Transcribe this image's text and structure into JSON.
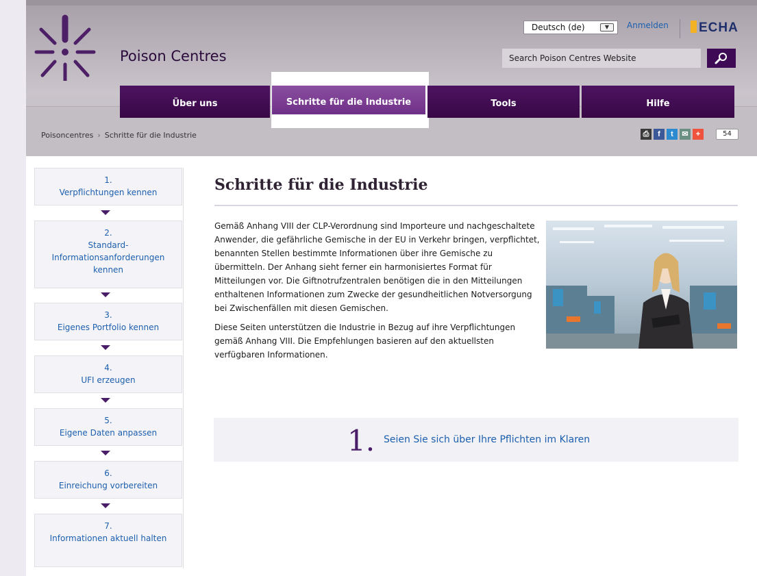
{
  "header": {
    "site_name": "Poison Centres",
    "language": "Deutsch (de)",
    "login_label": "Anmelden",
    "echa_logo_text": "ECHA",
    "search_placeholder": "Search Poison Centres Website"
  },
  "nav": {
    "tabs": [
      {
        "label": "Über uns"
      },
      {
        "label": "Schritte für die Industrie",
        "active": true
      },
      {
        "label": "Tools"
      },
      {
        "label": "Hilfe"
      }
    ]
  },
  "breadcrumb": {
    "home": "Poisoncentres",
    "separator": "›",
    "current": "Schritte für die Industrie"
  },
  "share": {
    "icons": [
      "print-icon",
      "facebook-icon",
      "twitter-icon",
      "email-icon",
      "addthis-icon"
    ],
    "count": "54"
  },
  "sidebar": {
    "steps": [
      {
        "num": "1.",
        "label": "Verpflichtungen kennen"
      },
      {
        "num": "2.",
        "label": "Standard-Informationsanforderungen kennen"
      },
      {
        "num": "3.",
        "label": "Eigenes Portfolio kennen"
      },
      {
        "num": "4.",
        "label": "UFI erzeugen"
      },
      {
        "num": "5.",
        "label": "Eigene Daten anpassen"
      },
      {
        "num": "6.",
        "label": "Einreichung vorbereiten"
      },
      {
        "num": "7.",
        "label": "Informationen aktuell halten"
      }
    ]
  },
  "main": {
    "title": "Schritte für die Industrie",
    "paragraphs": [
      "Gemäß Anhang VIII der CLP-Verordnung sind Importeure und nachgeschaltete Anwender, die gefährliche Gemische in der EU in Verkehr bringen, verpflichtet, benannten Stellen bestimmte Informationen über ihre Gemische zu übermitteln. Der Anhang sieht ferner ein harmonisiertes Format für Mitteilungen vor. Die Giftnotrufzentralen benötigen die in den Mitteilungen enthaltenen Informationen zum Zwecke der gesundheitlichen Notversorgung bei Zwischenfällen mit diesen Gemischen.",
      "Diese Seiten unterstützen die Industrie in Bezug auf ihre Verpflichtungen gemäß Anhang VIII. Die Empfehlungen basieren auf den aktuellsten verfügbaren Informationen."
    ],
    "step_card": {
      "num": "1.",
      "link": "Seien Sie sich über Ihre Pflichten im Klaren"
    }
  },
  "colors": {
    "nav": "#3f0a55",
    "nav_active": "#7a3a91",
    "link": "#1c5fae",
    "accent_yellow": "#f3b223"
  }
}
